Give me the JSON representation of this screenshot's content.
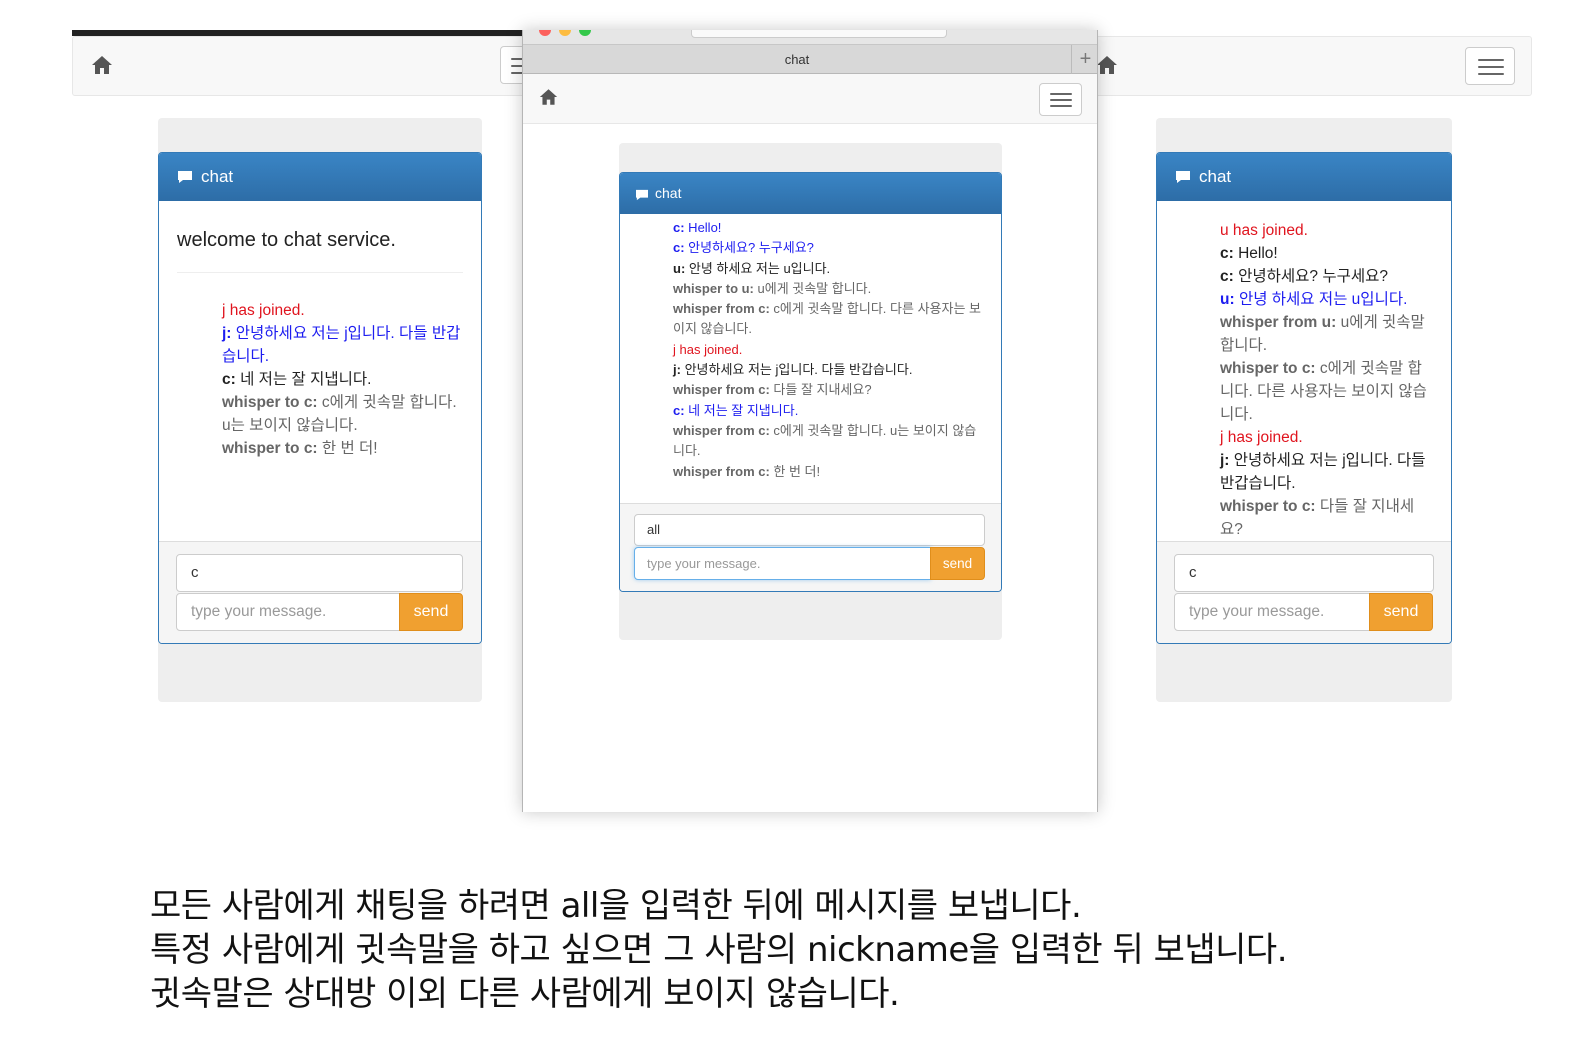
{
  "colors": {
    "panel_heading": "#2f72b0",
    "joined": "#e0141e",
    "self_message": "#1d1df0",
    "whisper": "#666666",
    "send_button": "#f0a030",
    "well": "#eeeeee"
  },
  "icons": {
    "home": "home-icon",
    "menu": "hamburger-menu-icon",
    "chat": "comment-icon"
  },
  "front_browser": {
    "tab_title": "chat",
    "new_tab": "+"
  },
  "left_panel": {
    "title": "chat",
    "welcome": "welcome to chat service.",
    "messages": [
      {
        "prefix": "",
        "text": "j has joined.",
        "style": "red"
      },
      {
        "prefix": "j:",
        "text": " 안녕하세요 저는 j입니다. 다들 반갑습니다.",
        "style": "blue"
      },
      {
        "prefix": "c:",
        "text": " 네 저는 잘 지냅니다.",
        "style": "black"
      },
      {
        "prefix": "whisper to c:",
        "text": " c에게 귓속말 합니다. u는 보이지 않습니다.",
        "style": "gray"
      },
      {
        "prefix": "whisper to c:",
        "text": " 한 번 더!",
        "style": "gray"
      }
    ],
    "target_value": "c",
    "message_placeholder": "type your message.",
    "send_label": "send"
  },
  "middle_panel": {
    "title": "chat",
    "messages": [
      {
        "prefix": "c:",
        "text": " Hello!",
        "style": "blue"
      },
      {
        "prefix": "c:",
        "text": " 안녕하세요? 누구세요?",
        "style": "blue"
      },
      {
        "prefix": "u:",
        "text": " 안녕 하세요 저는 u입니다.",
        "style": "black"
      },
      {
        "prefix": "whisper to u:",
        "text": " u에게 귓속말 합니다.",
        "style": "gray"
      },
      {
        "prefix": "whisper from c:",
        "text": " c에게 귓속말 합니다. 다른 사용자는 보이지 않습니다.",
        "style": "gray"
      },
      {
        "prefix": "",
        "text": "j has joined.",
        "style": "red"
      },
      {
        "prefix": "j:",
        "text": " 안녕하세요 저는 j입니다. 다들 반갑습니다.",
        "style": "black"
      },
      {
        "prefix": "whisper from c:",
        "text": " 다들 잘 지내세요?",
        "style": "gray"
      },
      {
        "prefix": "c:",
        "text": " 네 저는 잘 지냅니다.",
        "style": "blue"
      },
      {
        "prefix": "whisper from c:",
        "text": " c에게 귓속말 합니다. u는 보이지 않습니다.",
        "style": "gray"
      },
      {
        "prefix": "whisper from c:",
        "text": " 한 번 더!",
        "style": "gray"
      }
    ],
    "target_value": "all",
    "message_placeholder": "type your message.",
    "send_label": "send"
  },
  "right_panel": {
    "title": "chat",
    "messages": [
      {
        "prefix": "",
        "text": "u has joined.",
        "style": "red"
      },
      {
        "prefix": "c:",
        "text": " Hello!",
        "style": "black"
      },
      {
        "prefix": "c:",
        "text": " 안녕하세요? 누구세요?",
        "style": "black"
      },
      {
        "prefix": "u:",
        "text": " 안녕 하세요 저는 u입니다.",
        "style": "blue"
      },
      {
        "prefix": "whisper from u:",
        "text": " u에게 귓속말 합니다.",
        "style": "gray"
      },
      {
        "prefix": "whisper to c:",
        "text": " c에게 귓속말 합니다. 다른 사용자는 보이지 않습니다.",
        "style": "gray"
      },
      {
        "prefix": "",
        "text": "j has joined.",
        "style": "red"
      },
      {
        "prefix": "j:",
        "text": " 안녕하세요 저는 j입니다. 다들 반갑습니다.",
        "style": "black"
      },
      {
        "prefix": "whisper to c:",
        "text": " 다들 잘 지내세요?",
        "style": "gray"
      }
    ],
    "target_value": "c",
    "message_placeholder": "type your message.",
    "send_label": "send"
  },
  "caption": [
    "모든 사람에게 채팅을 하려면 all을 입력한 뒤에 메시지를 보냅니다.",
    "특정 사람에게 귓속말을 하고 싶으면 그 사람의 nickname을 입력한 뒤 보냅니다.",
    "귓속말은 상대방 이외 다른 사람에게 보이지 않습니다."
  ]
}
